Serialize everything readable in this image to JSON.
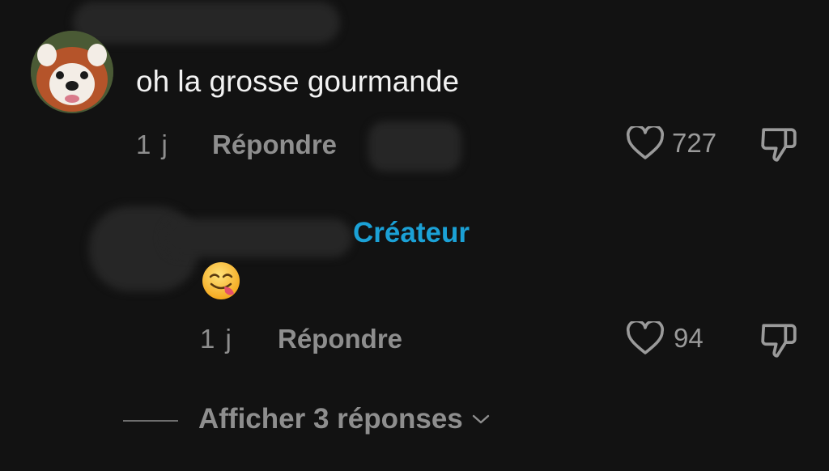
{
  "comment": {
    "text": "oh la grosse gourmande",
    "time": "1 j",
    "reply_label": "Répondre",
    "likes": "727"
  },
  "reply": {
    "badge": "Créateur",
    "emoji": "😋",
    "time": "1 j",
    "reply_label": "Répondre",
    "likes": "94"
  },
  "view_replies": {
    "label": "Afficher 3 réponses"
  },
  "colors": {
    "background": "#121212",
    "creator_badge": "#1ba1d6",
    "muted_text": "#8e8e8e"
  }
}
